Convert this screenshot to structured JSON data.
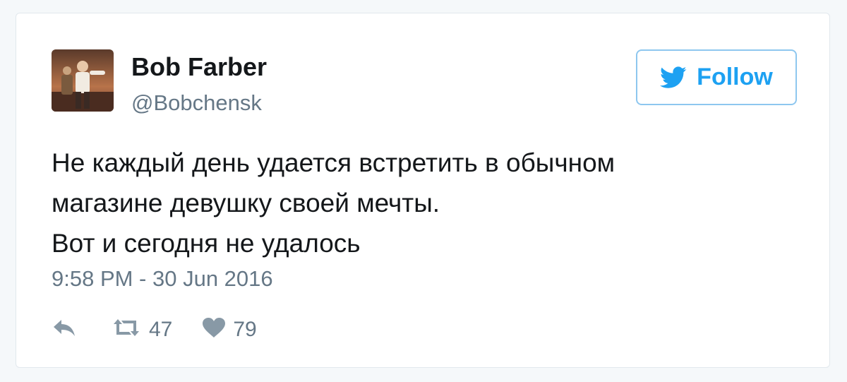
{
  "user": {
    "name": "Bob Farber",
    "handle": "@Bobchensk",
    "avatar_icon": "user-avatar-photo"
  },
  "follow": {
    "label": "Follow",
    "icon": "twitter-bird-icon",
    "color": "#1da1f2",
    "border_color": "#8ec7ef"
  },
  "tweet": {
    "lines": [
      "Не каждый день удается встретить в обычном",
      "магазине девушку своей мечты.",
      "Вот и сегодня не удалось"
    ],
    "timestamp": "9:58 PM - 30 Jun 2016"
  },
  "actions": {
    "reply": {
      "icon": "reply-icon"
    },
    "retweet": {
      "icon": "retweet-icon",
      "count": "47"
    },
    "like": {
      "icon": "heart-icon",
      "count": "79"
    }
  },
  "colors": {
    "text_primary": "#14171a",
    "text_secondary": "#657786",
    "card_border": "#e1e8ed",
    "background": "#f5f8fa"
  }
}
